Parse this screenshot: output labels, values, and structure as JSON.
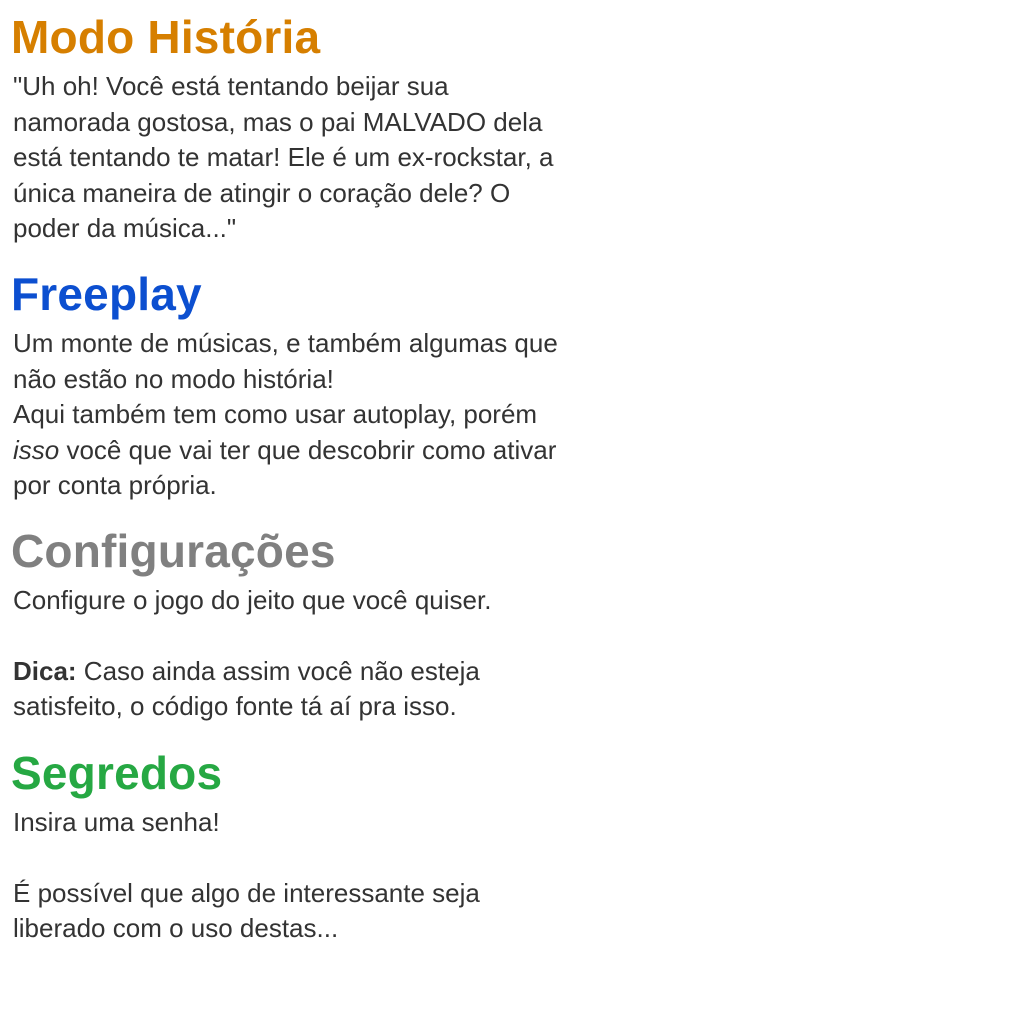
{
  "colors": {
    "story_heading": "#D67F00",
    "freeplay_heading": "#0C4FD0",
    "config_heading": "#808080",
    "secrets_heading": "#26A843",
    "body_text": "#333333"
  },
  "story": {
    "title": "Modo História",
    "lines": [
      "\"Uh oh! Você está tentando beijar sua",
      "namorada gostosa, mas o pai MALVADO dela",
      "está tentando te matar! Ele é um ex-rockstar, a",
      "única maneira de atingir o coração dele? O",
      "poder da música...\""
    ]
  },
  "freeplay": {
    "title": "Freeplay",
    "lines": [
      "Um monte de músicas, e também algumas que",
      "não estão no modo história!",
      "Aqui também tem como usar autoplay, porém"
    ],
    "line4_em": "isso",
    "line4_rest": " você que vai ter que descobrir como ativar",
    "line5": "por conta própria."
  },
  "config": {
    "title": "Configurações",
    "line1": "Configure o jogo do jeito que você quiser.",
    "tip_label": "Dica:",
    "tip_rest": " Caso ainda assim você não esteja",
    "tip_line2": "satisfeito, o código fonte tá aí pra isso."
  },
  "secrets": {
    "title": "Segredos",
    "line1": "Insira uma senha!",
    "line2": "É possível que algo de interessante seja",
    "line3": "liberado com o uso destas..."
  }
}
